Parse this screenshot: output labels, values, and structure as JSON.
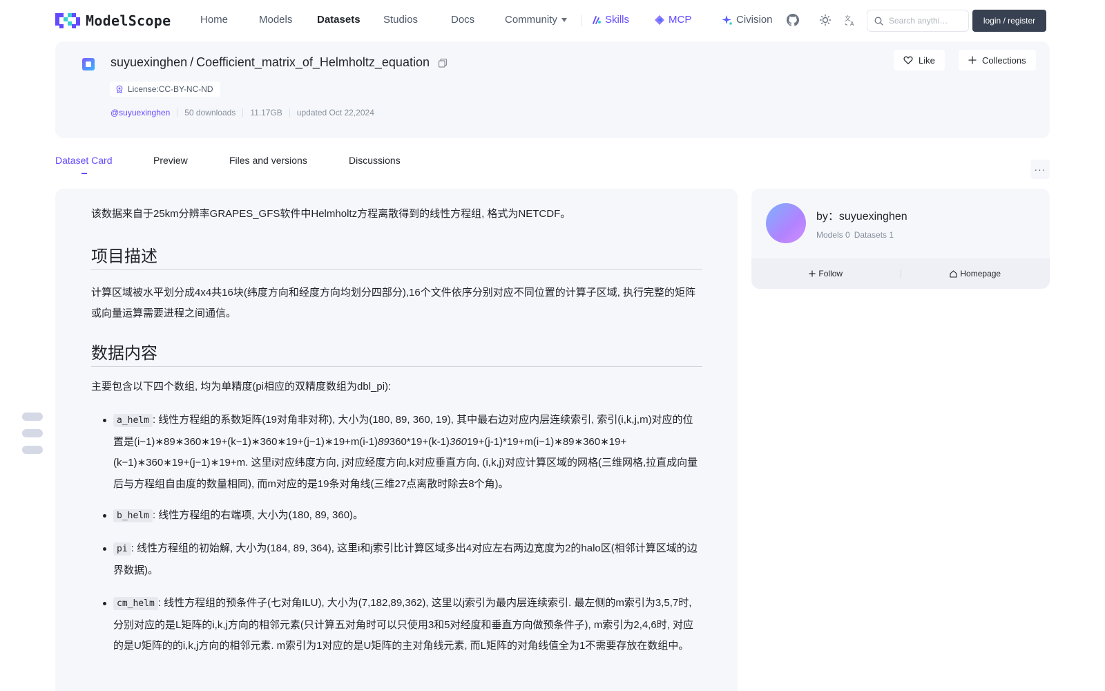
{
  "brand": {
    "name": "ModelScope"
  },
  "nav": {
    "items": [
      {
        "label": "Home"
      },
      {
        "label": "Models"
      },
      {
        "label": "Datasets"
      },
      {
        "label": "Studios"
      },
      {
        "label": "Docs"
      },
      {
        "label": "Community"
      },
      {
        "label": "Skills"
      },
      {
        "label": "MCP"
      },
      {
        "label": "Civision"
      }
    ],
    "search_placeholder": "Search anythi…",
    "login_label": "login / register"
  },
  "dataset": {
    "owner": "suyuexinghen",
    "separator": "/",
    "name": "Coefficient_matrix_of_Helmholtz_equation",
    "license": "License:CC-BY-NC-ND",
    "author_handle": "@suyuexinghen",
    "downloads": "50 downloads",
    "size": "11.17GB",
    "updated": "updated Oct 22,2024",
    "like_label": "Like",
    "collections_label": "Collections"
  },
  "tabs": [
    {
      "label": "Dataset Card",
      "active": true
    },
    {
      "label": "Preview"
    },
    {
      "label": "Files and versions"
    },
    {
      "label": "Discussions"
    }
  ],
  "more_label": "···",
  "card": {
    "intro": "该数据来自于25km分辨率GRAPES_GFS软件中Helmholtz方程离散得到的线性方程组, 格式为NETCDF。",
    "section1_title": "项目描述",
    "section1_text": "计算区域被水平划分成4x4共16块(纬度方向和经度方向均划分四部分),16个文件依序分别对应不同位置的计算子区域, 执行完整的矩阵或向量运算需要进程之间通信。",
    "section2_title": "数据内容",
    "section2_text": "主要包含以下四个数组, 均为单精度(pi相应的双精度数组为dbl_pi):",
    "items": [
      {
        "code": "a_helm",
        "t1": ": 线性方程组的系数矩阵(19对角非对称), 大小为(180, 89, 360, 19), 其中最右边对应内层连续索引, 索引(i,k,j,m)对应的位置是(i−1)∗89∗360∗19+(k−1)∗360∗19+(j−1)∗19+m(i-1)",
        "i1": "89",
        "t2": "360*19+(k-1)",
        "i2": "360",
        "t3": "19+(j-1)*19+m(i−1)∗89∗360∗19+(k−1)∗360∗19+(j−1)∗19+m. 这里i对应纬度方向, j对应经度方向,k对应垂直方向, (i,k,j)对应计算区域的网格(三维网格,拉直成向量后与方程组自由度的数量相同), 而m对应的是19条对角线(三维27点离散时除去8个角)。"
      },
      {
        "code": "b_helm",
        "text": ": 线性方程组的右端项, 大小为(180, 89, 360)。"
      },
      {
        "code": "pi",
        "text": ": 线性方程组的初始解, 大小为(184, 89, 364), 这里i和j索引比计算区域多出4对应左右两边宽度为2的halo区(相邻计算区域的边界数据)。"
      },
      {
        "code": "cm_helm",
        "text": ": 线性方程组的预条件子(七对角ILU), 大小为(7,182,89,362), 这里以j索引为最内层连续索引. 最左侧的m索引为3,5,7时,分别对应的是L矩阵的i,k,j方向的相邻元素(只计算五对角时可以只使用3和5对经度和垂直方向做预条件子), m索引为2,4,6时, 对应的是U矩阵的的i,k,j方向的相邻元素. m索引为1对应的是U矩阵的主对角线元素, 而L矩阵的对角线值全为1不需要存放在数组中。"
      }
    ]
  },
  "side": {
    "by_label": "by：suyuexinghen",
    "models": "Models 0",
    "datasets": "Datasets 1",
    "follow_label": "Follow",
    "homepage_label": "Homepage"
  }
}
